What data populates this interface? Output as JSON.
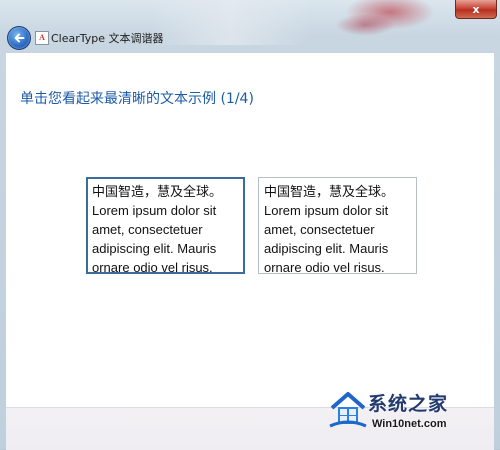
{
  "window": {
    "title": "ClearType 文本调谐器",
    "app_icon_letter": "A",
    "close_glyph": "x"
  },
  "main": {
    "heading": "单击您看起来最清晰的文本示例 (1/4)",
    "samples": [
      {
        "lines": [
          "中国智造，慧及全球。",
          "Lorem ipsum dolor sit",
          "amet, consectetuer",
          "adipiscing elit. Mauris",
          "ornare odio vel risus."
        ],
        "selected": true
      },
      {
        "lines": [
          "中国智造，慧及全球。",
          "Lorem ipsum dolor sit",
          "amet, consectetuer",
          "adipiscing elit. Mauris",
          "ornare odio vel risus."
        ],
        "selected": false
      }
    ]
  },
  "watermark": {
    "brand": "系统之家",
    "site": "Win10net.com"
  },
  "icons": {
    "back": "back-arrow-icon",
    "close": "close-icon",
    "app": "cleartype-app-icon",
    "watermark_logo": "house-logo-icon"
  },
  "colors": {
    "heading": "#1d5ba6",
    "selected_border": "#3c6c9c",
    "unselected_border": "#b9bec4",
    "close_button": "#c9473a"
  }
}
